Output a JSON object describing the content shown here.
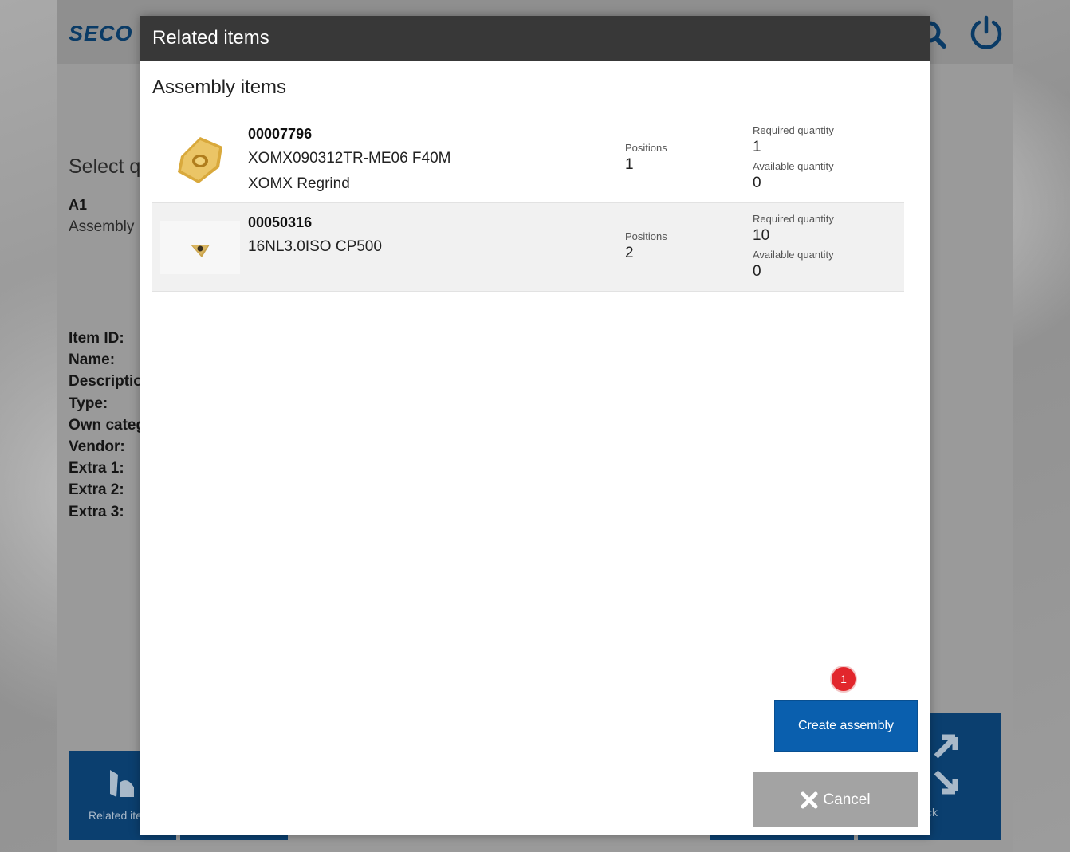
{
  "background": {
    "logo": "SECO",
    "title_partial": "Select q",
    "item_code": "A1",
    "item_type_partial": "Assembly",
    "fields": [
      "Item ID:",
      "Name:",
      "Descriptio",
      "Type:",
      "Own categ",
      "Vendor:",
      "Extra 1:",
      "Extra 2:",
      "Extra 3:"
    ],
    "related_button_partial": "Related ite",
    "back_button_partial": "ck"
  },
  "modal": {
    "title": "Related items",
    "section_title": "Assembly items",
    "items": [
      {
        "id": "00007796",
        "name": "XOMX090312TR-ME06 F40M",
        "description": "XOMX Regrind",
        "positions_label": "Positions",
        "positions": "1",
        "required_label": "Required quantity",
        "required": "1",
        "available_label": "Available quantity",
        "available": "0",
        "thumb_icon": "gold-square-insert-icon"
      },
      {
        "id": "00050316",
        "name": "16NL3.0ISO CP500",
        "description": "",
        "positions_label": "Positions",
        "positions": "2",
        "required_label": "Required quantity",
        "required": "10",
        "available_label": "Available quantity",
        "available": "0",
        "thumb_icon": "triangular-insert-icon"
      }
    ],
    "create_button": "Create assembly",
    "badge_count": "1",
    "cancel_button": "Cancel"
  },
  "colors": {
    "header_bg": "#383838",
    "primary": "#0a5fae",
    "badge": "#e2262c",
    "cancel_bg": "#a3a3a3"
  }
}
